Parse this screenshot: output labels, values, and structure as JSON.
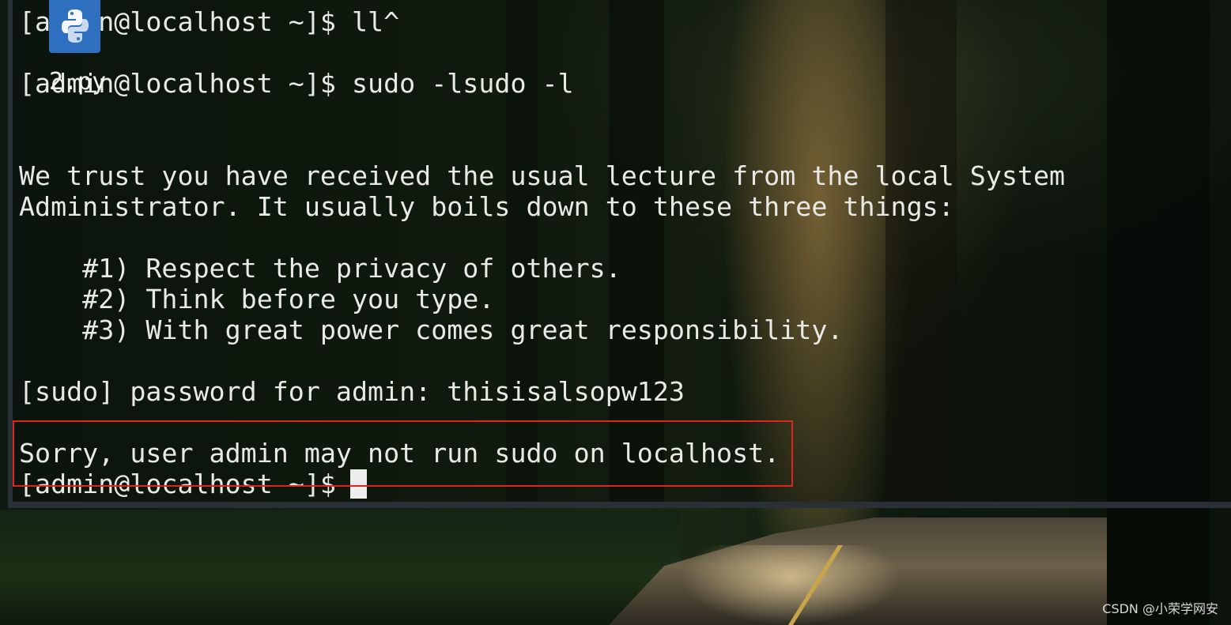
{
  "terminal": {
    "lines": {
      "l1": "[admin@localhost ~]$ ll^",
      "l2": "[admin@localhost ~]$ sudo -lsudo -l",
      "l3": "We trust you have received the usual lecture from the local System",
      "l4": "Administrator. It usually boils down to these three things:",
      "l5": "    #1) Respect the privacy of others.",
      "l6": "    #2) Think before you type.",
      "l7": "    #3) With great power comes great responsibility.",
      "l8": "[sudo] password for admin: thisisalsopw123",
      "l9": "Sorry, user admin may not run sudo on localhost.",
      "l10": "[admin@localhost ~]$ "
    }
  },
  "dock": {
    "icon_name": "python-file-icon",
    "label": "2.py"
  },
  "annotation": {
    "color": "#e0241f"
  },
  "watermark": {
    "text": "CSDN @小荣学网安"
  }
}
